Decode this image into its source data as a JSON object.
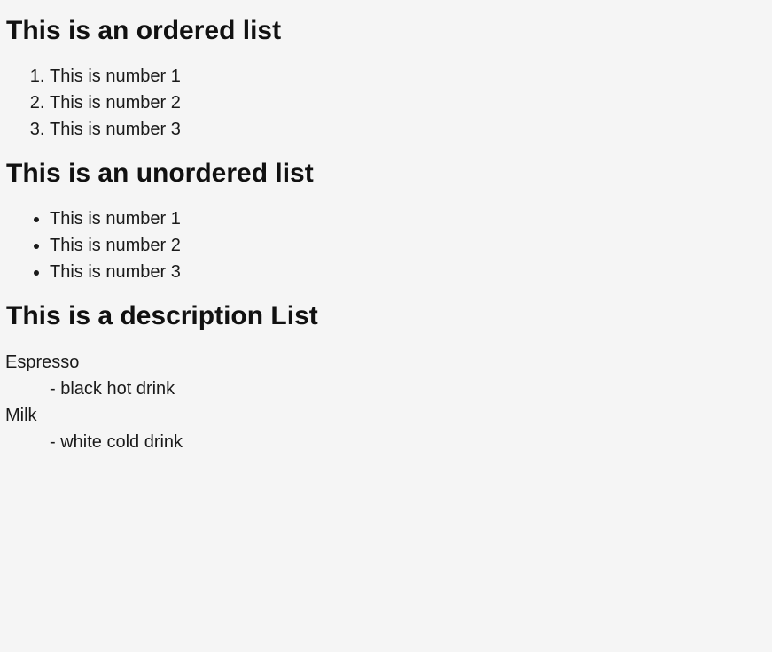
{
  "ordered": {
    "heading": "This is an ordered list",
    "items": [
      "This is number 1",
      "This is number 2",
      "This is number 3"
    ]
  },
  "unordered": {
    "heading": "This is an unordered list",
    "items": [
      "This is number 1",
      "This is number 2",
      "This is number 3"
    ]
  },
  "description": {
    "heading": "This is a description List",
    "items": [
      {
        "term": "Espresso",
        "definition": "- black hot drink"
      },
      {
        "term": "Milk",
        "definition": "- white cold drink"
      }
    ]
  }
}
